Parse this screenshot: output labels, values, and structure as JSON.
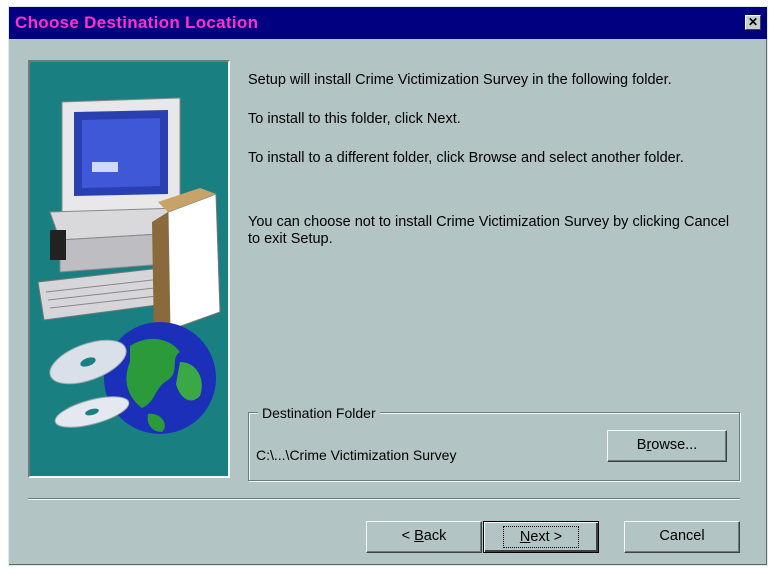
{
  "window": {
    "title": "Choose Destination Location",
    "close_glyph": "✕"
  },
  "content": {
    "paragraphs": [
      "Setup will install Crime Victimization Survey in the following folder.",
      "To install to this folder, click Next.",
      "To install to a different folder, click Browse and select another folder.",
      "You can choose not to install Crime Victimization Survey by clicking Cancel to exit Setup."
    ]
  },
  "destination": {
    "group_label": "Destination Folder",
    "path": "C:\\...\\Crime Victimization Survey",
    "browse_pre": "B",
    "browse_mnemonic": "r",
    "browse_post": "owse..."
  },
  "buttons": {
    "back_pre": "< ",
    "back_mnemonic": "B",
    "back_post": "ack",
    "next_mnemonic": "N",
    "next_post": "ext >",
    "cancel": "Cancel"
  },
  "colors": {
    "title_bar": "#000080",
    "title_text": "#ff33cc",
    "dialog_bg": "#b3c4c4",
    "art_bg": "#1a7f80"
  },
  "icons": {
    "art": "setup-computer-globe-illustration",
    "close": "close-icon"
  }
}
